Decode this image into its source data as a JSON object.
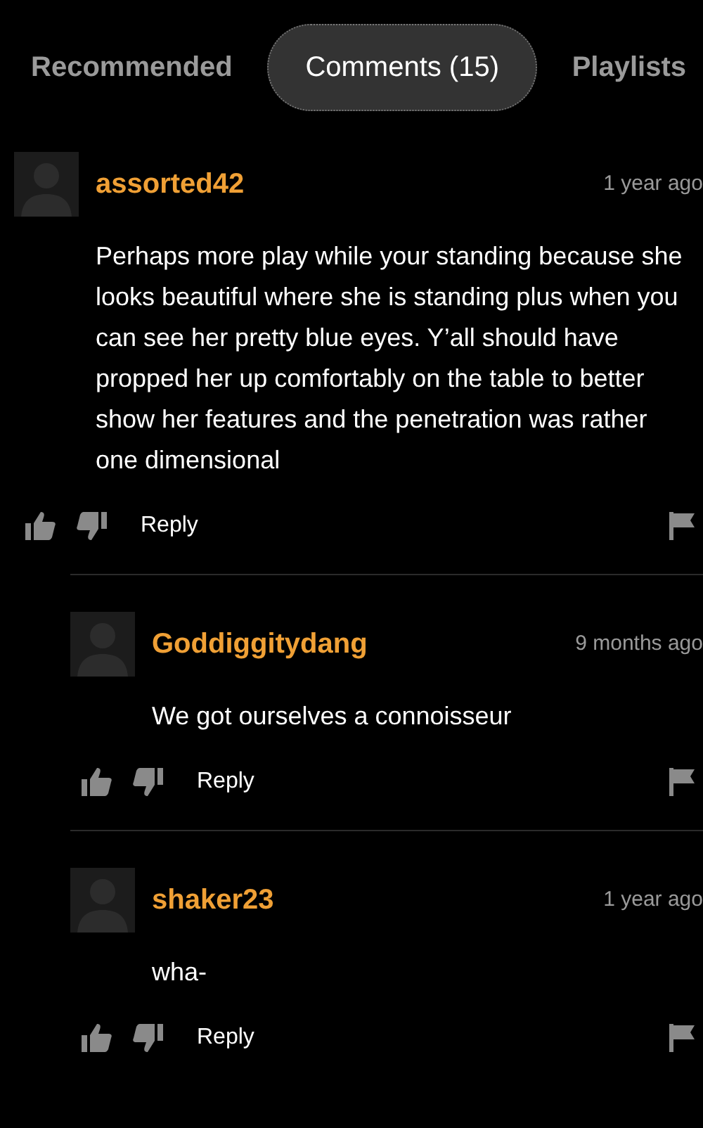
{
  "tabs": [
    {
      "label": "Recommended",
      "selected": false
    },
    {
      "label": "Comments (15)",
      "selected": true
    },
    {
      "label": "Playlists",
      "selected": false
    }
  ],
  "comments": [
    {
      "username": "assorted42",
      "time": "1 year ago",
      "text": "Perhaps more play while your standing because she looks beautiful where she is standing plus when you can see her pretty blue eyes. Y’all should have propped her up comfortably on the table to better show her features and the penetration was rather one dimensional",
      "reply_label": "Reply",
      "children": [
        {
          "username": "Goddiggitydang",
          "time": "9 months ago",
          "text": "We got ourselves a connoisseur",
          "reply_label": "Reply"
        },
        {
          "username": "shaker23",
          "time": "1 year ago",
          "text": "wha-",
          "reply_label": "Reply"
        }
      ]
    }
  ]
}
